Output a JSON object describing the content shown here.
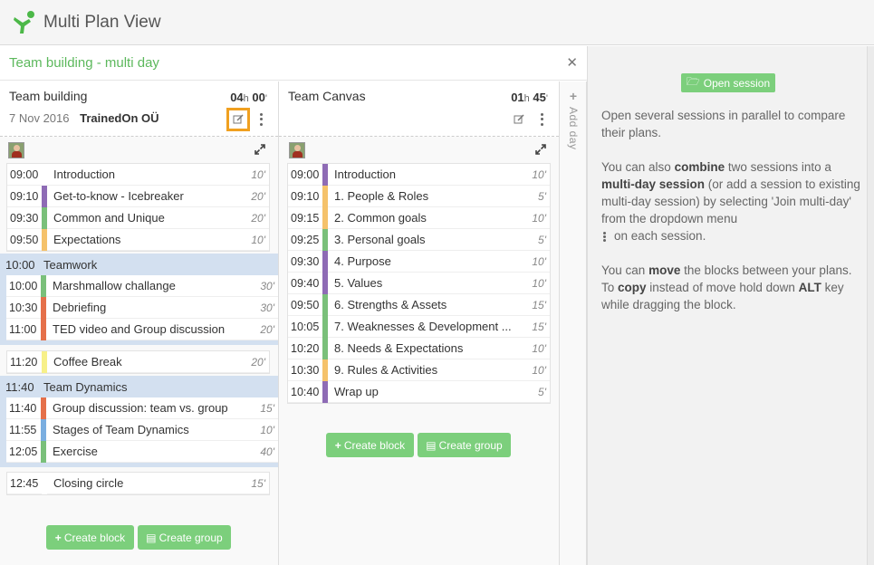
{
  "app": {
    "title": "Multi Plan View"
  },
  "multi": {
    "title": "Team building - multi day"
  },
  "add_day": {
    "label": "Add day"
  },
  "sessions": [
    {
      "name": "Team building",
      "duration": {
        "hours": "04",
        "h": "h",
        "minutes": "00",
        "m": "'"
      },
      "date": "7 Nov 2016",
      "organization": "TrainedOn OÜ",
      "blocks_a": [
        {
          "time": "09:00",
          "label": "Introduction",
          "dur": "10'",
          "color": "#ffffff"
        },
        {
          "time": "09:10",
          "label": "Get-to-know - Icebreaker",
          "dur": "20'",
          "color": "#8e6bb5"
        },
        {
          "time": "09:30",
          "label": "Common and Unique",
          "dur": "20'",
          "color": "#7ac07a"
        },
        {
          "time": "09:50",
          "label": "Expectations",
          "dur": "10'",
          "color": "#f5c26b"
        }
      ],
      "group1": {
        "time": "10:00",
        "label": "Teamwork",
        "blocks": [
          {
            "time": "10:00",
            "label": "Marshmallow challange",
            "dur": "30'",
            "color": "#7ac07a"
          },
          {
            "time": "10:30",
            "label": "Debriefing",
            "dur": "30'",
            "color": "#e5704a"
          },
          {
            "time": "11:00",
            "label": "TED video and Group discussion",
            "dur": "20'",
            "color": "#e5704a"
          }
        ]
      },
      "coffee": {
        "time": "11:20",
        "label": "Coffee Break",
        "dur": "20'",
        "color": "#f7f089"
      },
      "group2": {
        "time": "11:40",
        "label": "Team Dynamics",
        "blocks": [
          {
            "time": "11:40",
            "label": "Group discussion: team vs. group",
            "dur": "15'",
            "color": "#e5704a"
          },
          {
            "time": "11:55",
            "label": "Stages of Team Dynamics",
            "dur": "10'",
            "color": "#7aaee0"
          },
          {
            "time": "12:05",
            "label": "Exercise",
            "dur": "40'",
            "color": "#7ac07a"
          }
        ]
      },
      "closing": {
        "time": "12:45",
        "label": "Closing circle",
        "dur": "15'",
        "color": "#ffffff"
      }
    },
    {
      "name": "Team Canvas",
      "duration": {
        "hours": "01",
        "h": "h",
        "minutes": "45",
        "m": "'"
      },
      "blocks": [
        {
          "time": "09:00",
          "label": "Introduction",
          "dur": "10'",
          "color": "#8e6bb5"
        },
        {
          "time": "09:10",
          "label": "1. People & Roles",
          "dur": "5'",
          "color": "#f5c26b"
        },
        {
          "time": "09:15",
          "label": "2. Common goals",
          "dur": "10'",
          "color": "#f5c26b"
        },
        {
          "time": "09:25",
          "label": "3. Personal goals",
          "dur": "5'",
          "color": "#7ac07a"
        },
        {
          "time": "09:30",
          "label": "4. Purpose",
          "dur": "10'",
          "color": "#8e6bb5"
        },
        {
          "time": "09:40",
          "label": "5. Values",
          "dur": "10'",
          "color": "#8e6bb5"
        },
        {
          "time": "09:50",
          "label": "6. Strengths & Assets",
          "dur": "15'",
          "color": "#7ac07a"
        },
        {
          "time": "10:05",
          "label": "7. Weaknesses & Development ...",
          "dur": "15'",
          "color": "#7ac07a"
        },
        {
          "time": "10:20",
          "label": "8. Needs & Expectations",
          "dur": "10'",
          "color": "#7ac07a"
        },
        {
          "time": "10:30",
          "label": "9. Rules & Activities",
          "dur": "10'",
          "color": "#f5c26b"
        },
        {
          "time": "10:40",
          "label": "Wrap up",
          "dur": "5'",
          "color": "#8e6bb5"
        }
      ]
    }
  ],
  "buttons": {
    "create_block": "Create block",
    "create_group": "Create group",
    "open_session": "Open session"
  },
  "help": {
    "p1": "Open several sessions in parallel to compare their plans.",
    "p2_a": "You can also ",
    "p2_b": "combine",
    "p2_c": " two sessions into a ",
    "p2_d": "multi-day session",
    "p2_e": " (or add a session to existing multi-day session) by selecting 'Join multi-day' from the dropdown menu",
    "p2_f": "on each session.",
    "p3_a": "You can ",
    "p3_b": "move",
    "p3_c": " the blocks between your plans. To ",
    "p3_d": "copy",
    "p3_e": " instead of move hold down ",
    "p3_f": "ALT",
    "p3_g": " key while dragging the block."
  }
}
